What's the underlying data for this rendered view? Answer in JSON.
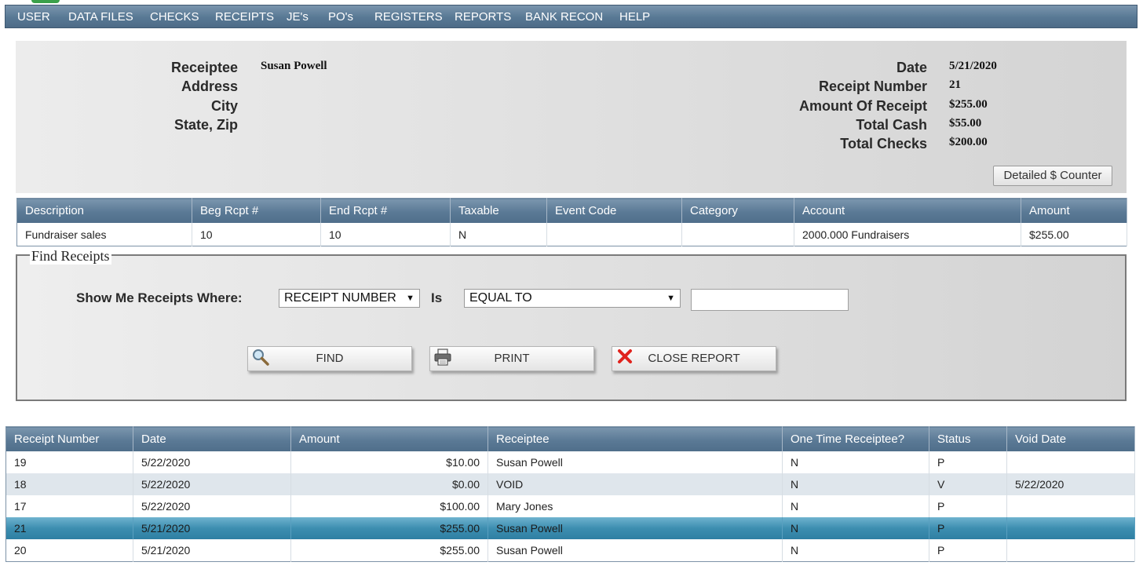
{
  "nav": [
    "USER",
    "DATA FILES",
    "CHECKS",
    "RECEIPTS",
    "JE's",
    "PO's",
    "REGISTERS",
    "REPORTS",
    "BANK RECON",
    "HELP"
  ],
  "header": {
    "receiptee_label": "Receiptee",
    "receiptee_value": "Susan Powell",
    "address_label": "Address",
    "city_label": "City",
    "state_zip_label": "State, Zip",
    "date_label": "Date",
    "date_value": "5/21/2020",
    "receipt_number_label": "Receipt Number",
    "receipt_number_value": "21",
    "amount_label": "Amount Of Receipt",
    "amount_value": "$255.00",
    "total_cash_label": "Total Cash",
    "total_cash_value": "$55.00",
    "total_checks_label": "Total Checks",
    "total_checks_value": "$200.00",
    "detailed_counter_button": "Detailed $ Counter"
  },
  "detail_table": {
    "columns": [
      "Description",
      "Beg Rcpt #",
      "End Rcpt #",
      "Taxable",
      "Event Code",
      "Category",
      "Account",
      "Amount"
    ],
    "rows": [
      [
        "Fundraiser sales",
        "10",
        "10",
        "N",
        "",
        "",
        "2000.000 Fundraisers",
        "$255.00"
      ]
    ]
  },
  "find": {
    "legend": "Find Receipts",
    "show_label": "Show Me Receipts Where:",
    "field_select": "RECEIPT NUMBER",
    "is_label": "Is",
    "operator_select": "EQUAL TO",
    "search_value": "",
    "find_button": "FIND",
    "print_button": "PRINT",
    "close_button": "CLOSE REPORT"
  },
  "results": {
    "columns": [
      "Receipt Number",
      "Date",
      "Amount",
      "Receiptee",
      "One Time Receiptee?",
      "Status",
      "Void Date"
    ],
    "rows": [
      [
        "19",
        "5/22/2020",
        "$10.00",
        "Susan Powell",
        "N",
        "P",
        ""
      ],
      [
        "18",
        "5/22/2020",
        "$0.00",
        "VOID",
        "N",
        "V",
        "5/22/2020"
      ],
      [
        "17",
        "5/22/2020",
        "$100.00",
        "Mary Jones",
        "N",
        "P",
        ""
      ],
      [
        "21",
        "5/21/2020",
        "$255.00",
        "Susan Powell",
        "N",
        "P",
        ""
      ],
      [
        "20",
        "5/21/2020",
        "$255.00",
        "Susan Powell",
        "N",
        "P",
        ""
      ]
    ],
    "selected_row": 3
  }
}
